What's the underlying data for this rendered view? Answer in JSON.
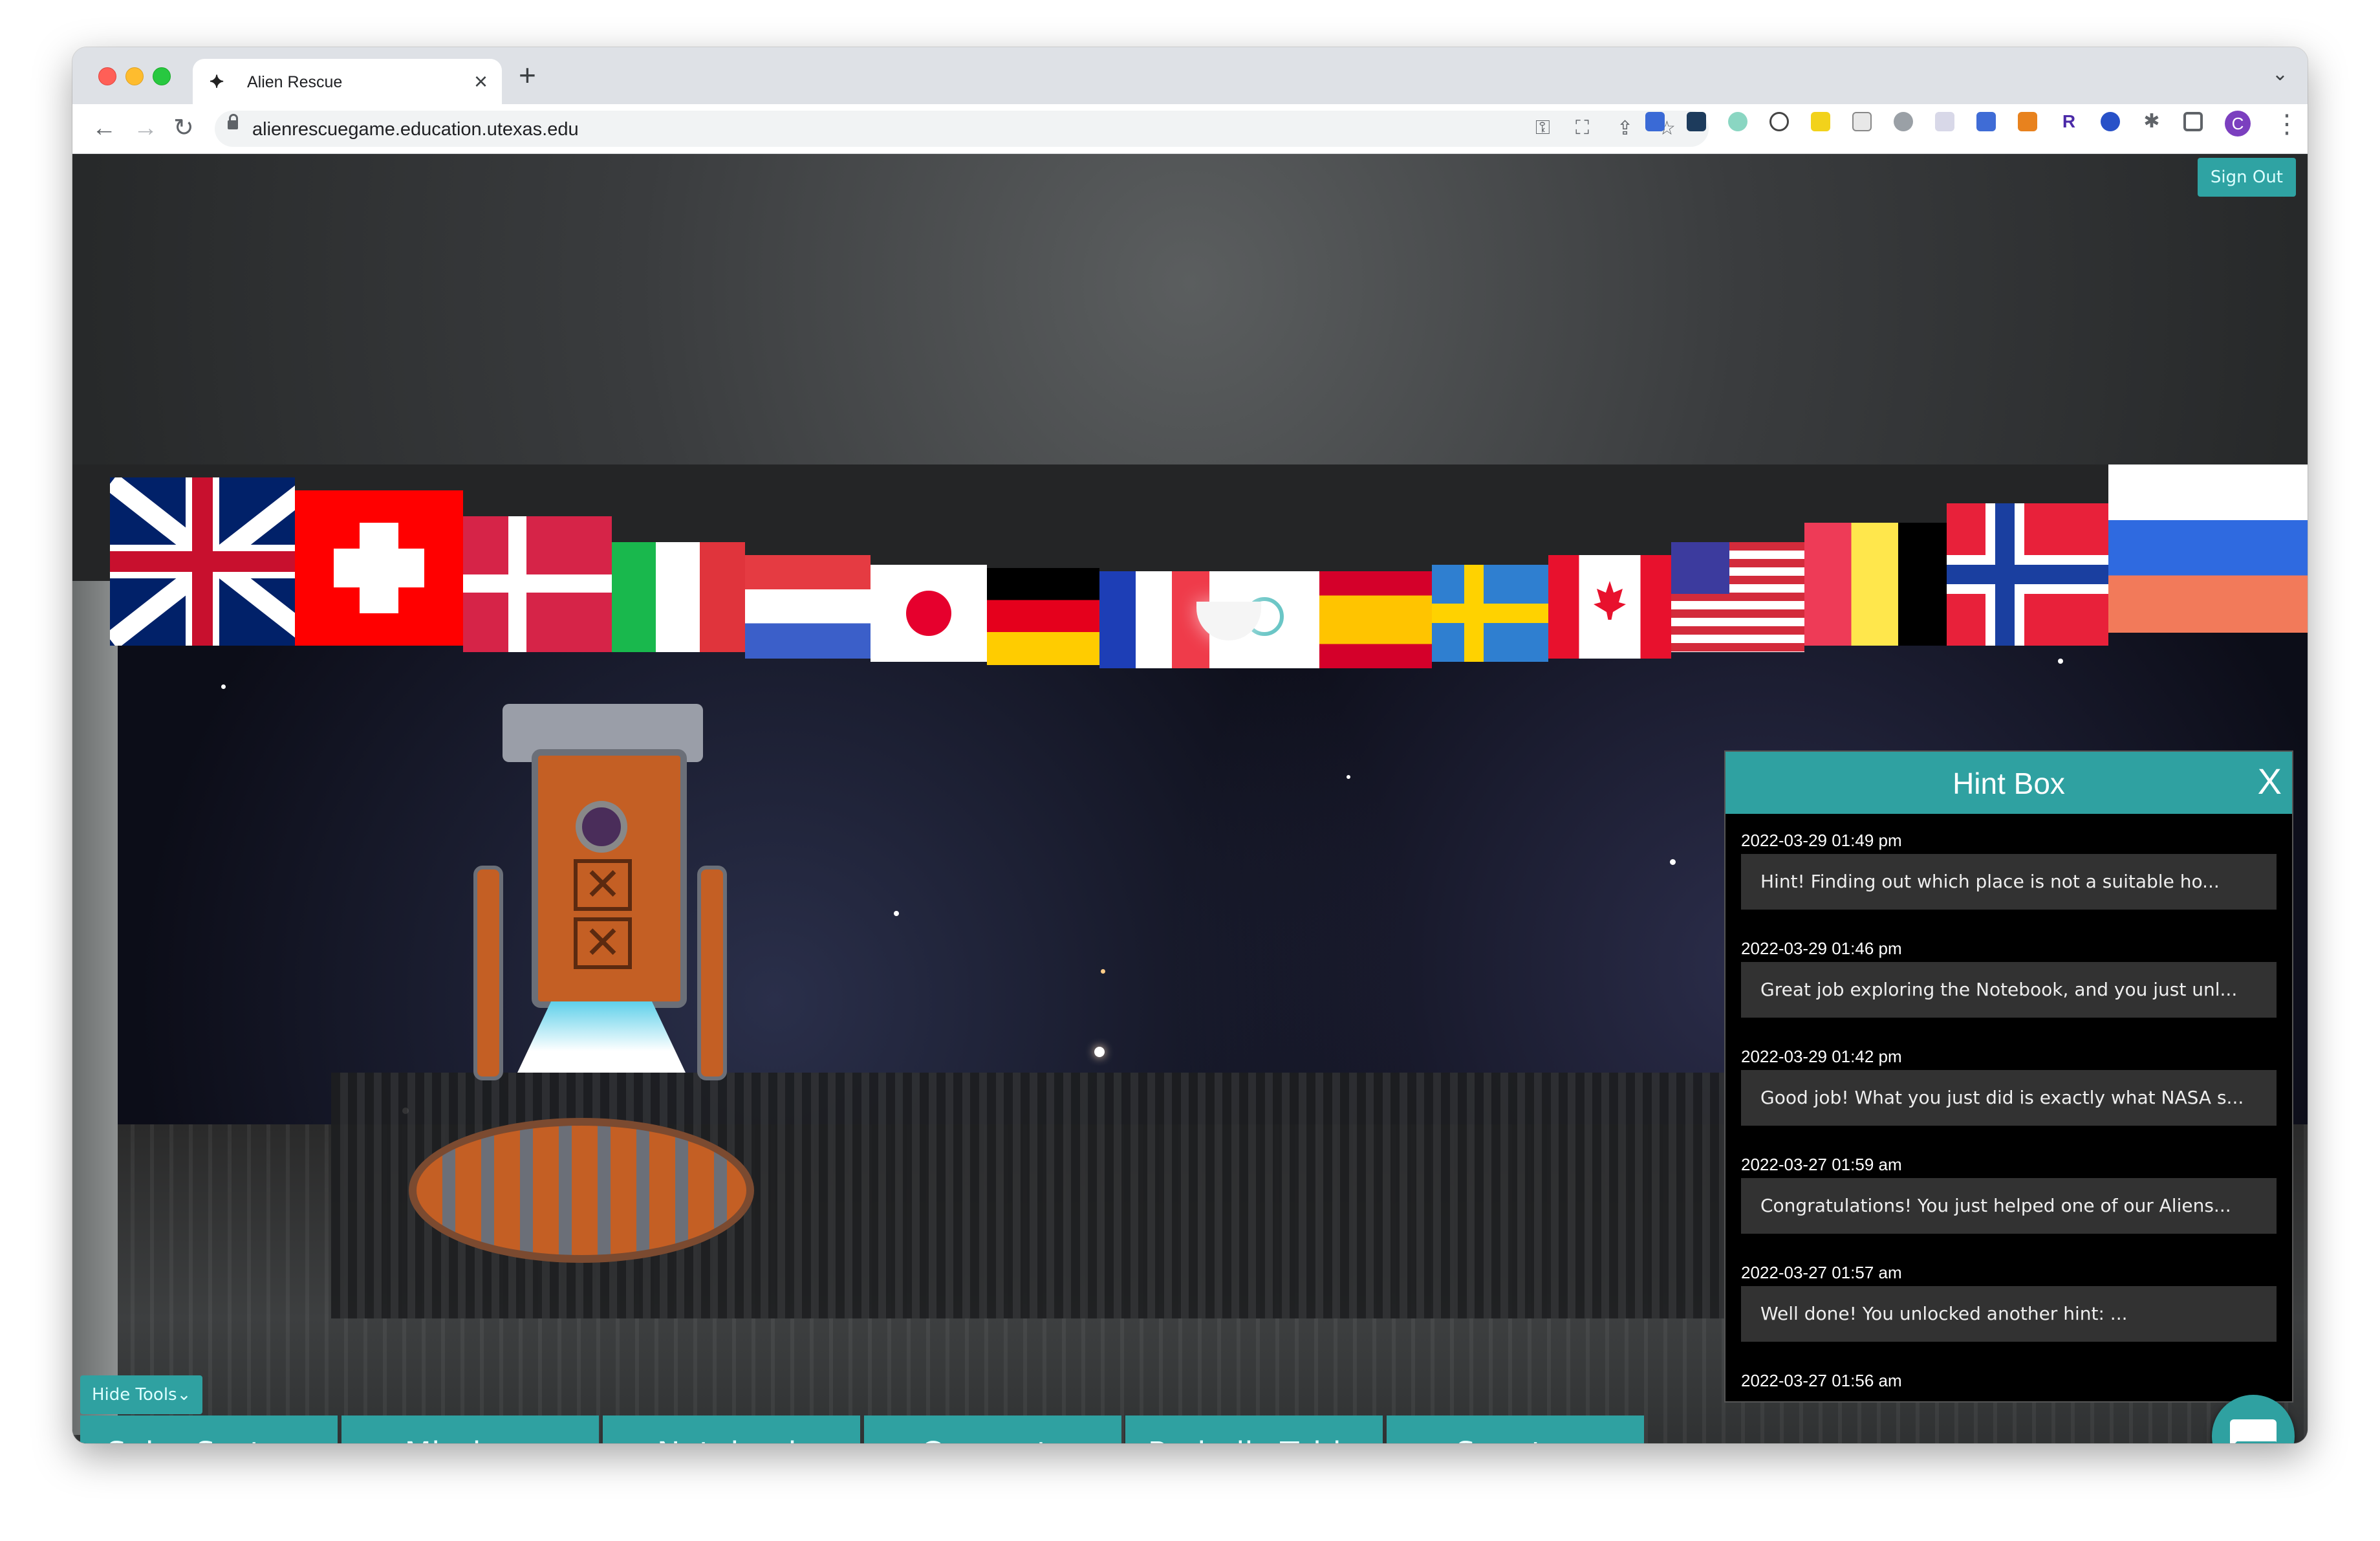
{
  "browser": {
    "tab_title": "Alien Rescue",
    "new_tab_icon": "plus-icon",
    "url": "alienrescuegame.education.utexas.edu",
    "profile_initial": "C"
  },
  "game": {
    "sign_out_label": "Sign Out",
    "hide_tools_label": "Hide Tools",
    "tools": [
      {
        "label": "Solar System"
      },
      {
        "label": "Missions"
      },
      {
        "label": "Notebook"
      },
      {
        "label": "Concepts"
      },
      {
        "label": "Periodic Table"
      },
      {
        "label": "Spectra"
      }
    ]
  },
  "hint_box": {
    "title": "Hint Box",
    "close_label": "X",
    "hints": [
      {
        "timestamp": "2022-03-29 01:49 pm",
        "message": "Hint! Finding out which place is not a suitable ho..."
      },
      {
        "timestamp": "2022-03-29 01:46 pm",
        "message": "Great job exploring the Notebook, and you just unl..."
      },
      {
        "timestamp": "2022-03-29 01:42 pm",
        "message": "Good job! What you just did is exactly what NASA s..."
      },
      {
        "timestamp": "2022-03-27 01:59 am",
        "message": "Congratulations! You just helped one of our Aliens..."
      },
      {
        "timestamp": "2022-03-27 01:57 am",
        "message": "Well done! You unlocked another hint: ..."
      },
      {
        "timestamp": "2022-03-27 01:56 am",
        "message": ""
      }
    ]
  },
  "colors": {
    "teal_accent": "#2fa1a1",
    "hint_message_bg": "#323232"
  }
}
